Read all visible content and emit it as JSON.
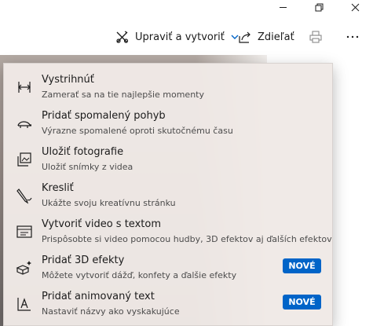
{
  "commandbar": {
    "edit_create_label": "Upraviť a vytvoriť",
    "share_label": "Zdieľať"
  },
  "menu": {
    "items": [
      {
        "title": "Vystrihnúť",
        "subtitle": "Zamerať sa na tie najlepšie momenty",
        "icon": "trim-icon"
      },
      {
        "title": "Pridať spomalený pohyb",
        "subtitle": "Výrazne spomalené oproti skutočnému času",
        "icon": "slow-motion-icon"
      },
      {
        "title": "Uložiť fotografie",
        "subtitle": "Uložiť snímky z videa",
        "icon": "save-photos-icon"
      },
      {
        "title": "Kresliť",
        "subtitle": "Ukážte svoju kreatívnu stránku",
        "icon": "draw-icon"
      },
      {
        "title": "Vytvoriť video s textom",
        "subtitle": "Prispôsobte si video pomocou hudby, 3D efektov aj ďalších efektov",
        "icon": "video-text-icon"
      },
      {
        "title": "Pridať 3D efekty",
        "subtitle": "Môžete vytvoriť dážď, konfety a ďalšie efekty",
        "icon": "3d-effects-icon",
        "badge": "NOVÉ"
      },
      {
        "title": "Pridať animovaný text",
        "subtitle": "Nastaviť názvy ako vyskakujúce",
        "icon": "animated-text-icon",
        "badge": "NOVÉ"
      }
    ]
  },
  "colors": {
    "accent": "#0064c8",
    "menu_bg": "#efe9e6"
  }
}
